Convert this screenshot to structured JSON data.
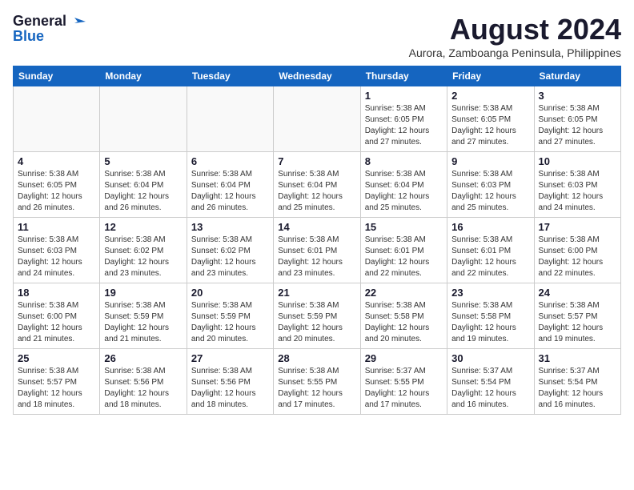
{
  "header": {
    "logo_line1": "General",
    "logo_line2": "Blue",
    "month_year": "August 2024",
    "location": "Aurora, Zamboanga Peninsula, Philippines"
  },
  "weekdays": [
    "Sunday",
    "Monday",
    "Tuesday",
    "Wednesday",
    "Thursday",
    "Friday",
    "Saturday"
  ],
  "weeks": [
    [
      {
        "day": "",
        "info": ""
      },
      {
        "day": "",
        "info": ""
      },
      {
        "day": "",
        "info": ""
      },
      {
        "day": "",
        "info": ""
      },
      {
        "day": "1",
        "info": "Sunrise: 5:38 AM\nSunset: 6:05 PM\nDaylight: 12 hours\nand 27 minutes."
      },
      {
        "day": "2",
        "info": "Sunrise: 5:38 AM\nSunset: 6:05 PM\nDaylight: 12 hours\nand 27 minutes."
      },
      {
        "day": "3",
        "info": "Sunrise: 5:38 AM\nSunset: 6:05 PM\nDaylight: 12 hours\nand 27 minutes."
      }
    ],
    [
      {
        "day": "4",
        "info": "Sunrise: 5:38 AM\nSunset: 6:05 PM\nDaylight: 12 hours\nand 26 minutes."
      },
      {
        "day": "5",
        "info": "Sunrise: 5:38 AM\nSunset: 6:04 PM\nDaylight: 12 hours\nand 26 minutes."
      },
      {
        "day": "6",
        "info": "Sunrise: 5:38 AM\nSunset: 6:04 PM\nDaylight: 12 hours\nand 26 minutes."
      },
      {
        "day": "7",
        "info": "Sunrise: 5:38 AM\nSunset: 6:04 PM\nDaylight: 12 hours\nand 25 minutes."
      },
      {
        "day": "8",
        "info": "Sunrise: 5:38 AM\nSunset: 6:04 PM\nDaylight: 12 hours\nand 25 minutes."
      },
      {
        "day": "9",
        "info": "Sunrise: 5:38 AM\nSunset: 6:03 PM\nDaylight: 12 hours\nand 25 minutes."
      },
      {
        "day": "10",
        "info": "Sunrise: 5:38 AM\nSunset: 6:03 PM\nDaylight: 12 hours\nand 24 minutes."
      }
    ],
    [
      {
        "day": "11",
        "info": "Sunrise: 5:38 AM\nSunset: 6:03 PM\nDaylight: 12 hours\nand 24 minutes."
      },
      {
        "day": "12",
        "info": "Sunrise: 5:38 AM\nSunset: 6:02 PM\nDaylight: 12 hours\nand 23 minutes."
      },
      {
        "day": "13",
        "info": "Sunrise: 5:38 AM\nSunset: 6:02 PM\nDaylight: 12 hours\nand 23 minutes."
      },
      {
        "day": "14",
        "info": "Sunrise: 5:38 AM\nSunset: 6:01 PM\nDaylight: 12 hours\nand 23 minutes."
      },
      {
        "day": "15",
        "info": "Sunrise: 5:38 AM\nSunset: 6:01 PM\nDaylight: 12 hours\nand 22 minutes."
      },
      {
        "day": "16",
        "info": "Sunrise: 5:38 AM\nSunset: 6:01 PM\nDaylight: 12 hours\nand 22 minutes."
      },
      {
        "day": "17",
        "info": "Sunrise: 5:38 AM\nSunset: 6:00 PM\nDaylight: 12 hours\nand 22 minutes."
      }
    ],
    [
      {
        "day": "18",
        "info": "Sunrise: 5:38 AM\nSunset: 6:00 PM\nDaylight: 12 hours\nand 21 minutes."
      },
      {
        "day": "19",
        "info": "Sunrise: 5:38 AM\nSunset: 5:59 PM\nDaylight: 12 hours\nand 21 minutes."
      },
      {
        "day": "20",
        "info": "Sunrise: 5:38 AM\nSunset: 5:59 PM\nDaylight: 12 hours\nand 20 minutes."
      },
      {
        "day": "21",
        "info": "Sunrise: 5:38 AM\nSunset: 5:59 PM\nDaylight: 12 hours\nand 20 minutes."
      },
      {
        "day": "22",
        "info": "Sunrise: 5:38 AM\nSunset: 5:58 PM\nDaylight: 12 hours\nand 20 minutes."
      },
      {
        "day": "23",
        "info": "Sunrise: 5:38 AM\nSunset: 5:58 PM\nDaylight: 12 hours\nand 19 minutes."
      },
      {
        "day": "24",
        "info": "Sunrise: 5:38 AM\nSunset: 5:57 PM\nDaylight: 12 hours\nand 19 minutes."
      }
    ],
    [
      {
        "day": "25",
        "info": "Sunrise: 5:38 AM\nSunset: 5:57 PM\nDaylight: 12 hours\nand 18 minutes."
      },
      {
        "day": "26",
        "info": "Sunrise: 5:38 AM\nSunset: 5:56 PM\nDaylight: 12 hours\nand 18 minutes."
      },
      {
        "day": "27",
        "info": "Sunrise: 5:38 AM\nSunset: 5:56 PM\nDaylight: 12 hours\nand 18 minutes."
      },
      {
        "day": "28",
        "info": "Sunrise: 5:38 AM\nSunset: 5:55 PM\nDaylight: 12 hours\nand 17 minutes."
      },
      {
        "day": "29",
        "info": "Sunrise: 5:37 AM\nSunset: 5:55 PM\nDaylight: 12 hours\nand 17 minutes."
      },
      {
        "day": "30",
        "info": "Sunrise: 5:37 AM\nSunset: 5:54 PM\nDaylight: 12 hours\nand 16 minutes."
      },
      {
        "day": "31",
        "info": "Sunrise: 5:37 AM\nSunset: 5:54 PM\nDaylight: 12 hours\nand 16 minutes."
      }
    ]
  ]
}
